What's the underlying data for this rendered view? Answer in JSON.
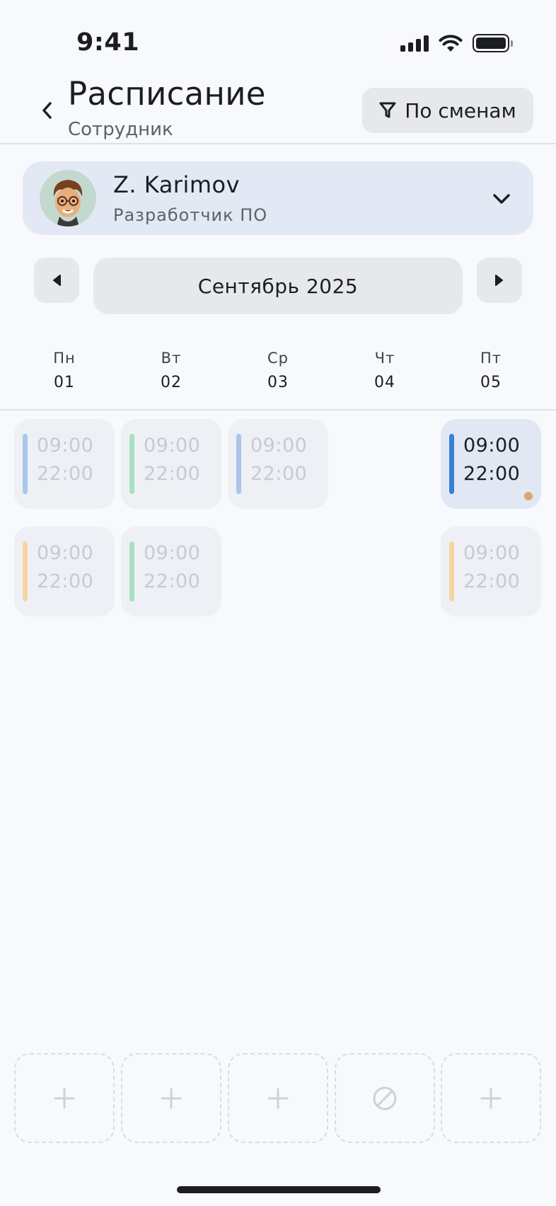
{
  "status_bar": {
    "time": "9:41"
  },
  "header": {
    "title": "Расписание",
    "subtitle": "Сотрудник",
    "filter_label": "По сменам"
  },
  "employee": {
    "name": "Z. Karimov",
    "role": "Разработчик ПО"
  },
  "calendar": {
    "month_label": "Сентябрь 2025",
    "days": [
      {
        "name": "Пн",
        "num": "01"
      },
      {
        "name": "Вт",
        "num": "02"
      },
      {
        "name": "Ср",
        "num": "03"
      },
      {
        "name": "Чт",
        "num": "04"
      },
      {
        "name": "Пт",
        "num": "05"
      }
    ]
  },
  "shifts": {
    "mon_1": {
      "start": "09:00",
      "end": "22:00",
      "color": "#a9c6ea"
    },
    "tue_1": {
      "start": "09:00",
      "end": "22:00",
      "color": "#a8e0c4"
    },
    "wed_1": {
      "start": "09:00",
      "end": "22:00",
      "color": "#a9c6ea"
    },
    "fri_1": {
      "start": "09:00",
      "end": "22:00",
      "color": "#3b7fd4",
      "active": true
    },
    "mon_2": {
      "start": "09:00",
      "end": "22:00",
      "color": "#f5d5a6"
    },
    "tue_2": {
      "start": "09:00",
      "end": "22:00",
      "color": "#a8e0c4"
    },
    "fri_2": {
      "start": "09:00",
      "end": "22:00",
      "color": "#f5d5a6"
    }
  },
  "slots": [
    {
      "icon": "plus-icon"
    },
    {
      "icon": "plus-icon"
    },
    {
      "icon": "plus-icon"
    },
    {
      "icon": "blocked-icon"
    },
    {
      "icon": "plus-icon"
    }
  ],
  "colors": {
    "accent": "#3b7fd4",
    "background": "#f7f9fd",
    "card": "#e3e9f4",
    "indicator_dot": "#d9a86f"
  }
}
